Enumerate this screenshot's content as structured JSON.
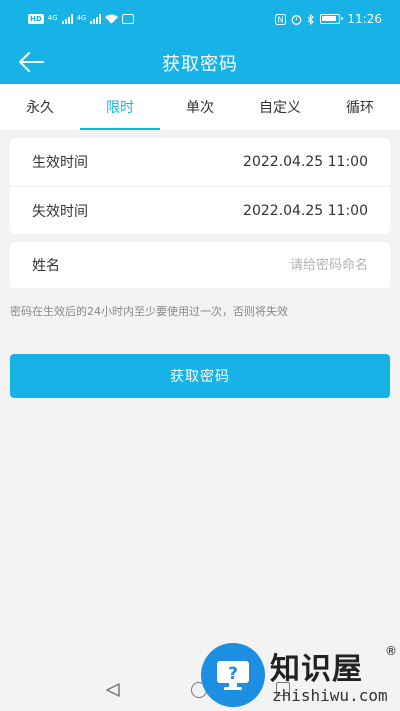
{
  "status_bar": {
    "sim1_badge": "HD",
    "sim1_network": "4G",
    "sim2_network": "4G",
    "time": "11:26",
    "icons": [
      "hd-badge-icon",
      "signal-icon",
      "wifi-icon",
      "message-icon",
      "nfc-icon",
      "alarm-icon",
      "bluetooth-icon",
      "battery-icon"
    ]
  },
  "header": {
    "title": "获取密码",
    "back_icon": "arrow-left-icon"
  },
  "tabs": [
    {
      "label": "永久",
      "active": false
    },
    {
      "label": "限时",
      "active": true
    },
    {
      "label": "单次",
      "active": false
    },
    {
      "label": "自定义",
      "active": false
    },
    {
      "label": "循环",
      "active": false
    }
  ],
  "form": {
    "start_label": "生效时间",
    "start_value": "2022.04.25 11:00",
    "end_label": "失效时间",
    "end_value": "2022.04.25 11:00",
    "name_label": "姓名",
    "name_placeholder": "请给密码命名",
    "name_value": ""
  },
  "hint": "密码在生效后的24小时内至少要使用过一次，否则将失效",
  "submit_label": "获取密码",
  "watermark": {
    "brand": "知识屋",
    "reg": "®",
    "domain": "zhishiwu.com"
  },
  "colors": {
    "primary": "#17b2e6",
    "background": "#f3f3f3",
    "hint_text": "#888888",
    "placeholder": "#b2b2b2"
  }
}
